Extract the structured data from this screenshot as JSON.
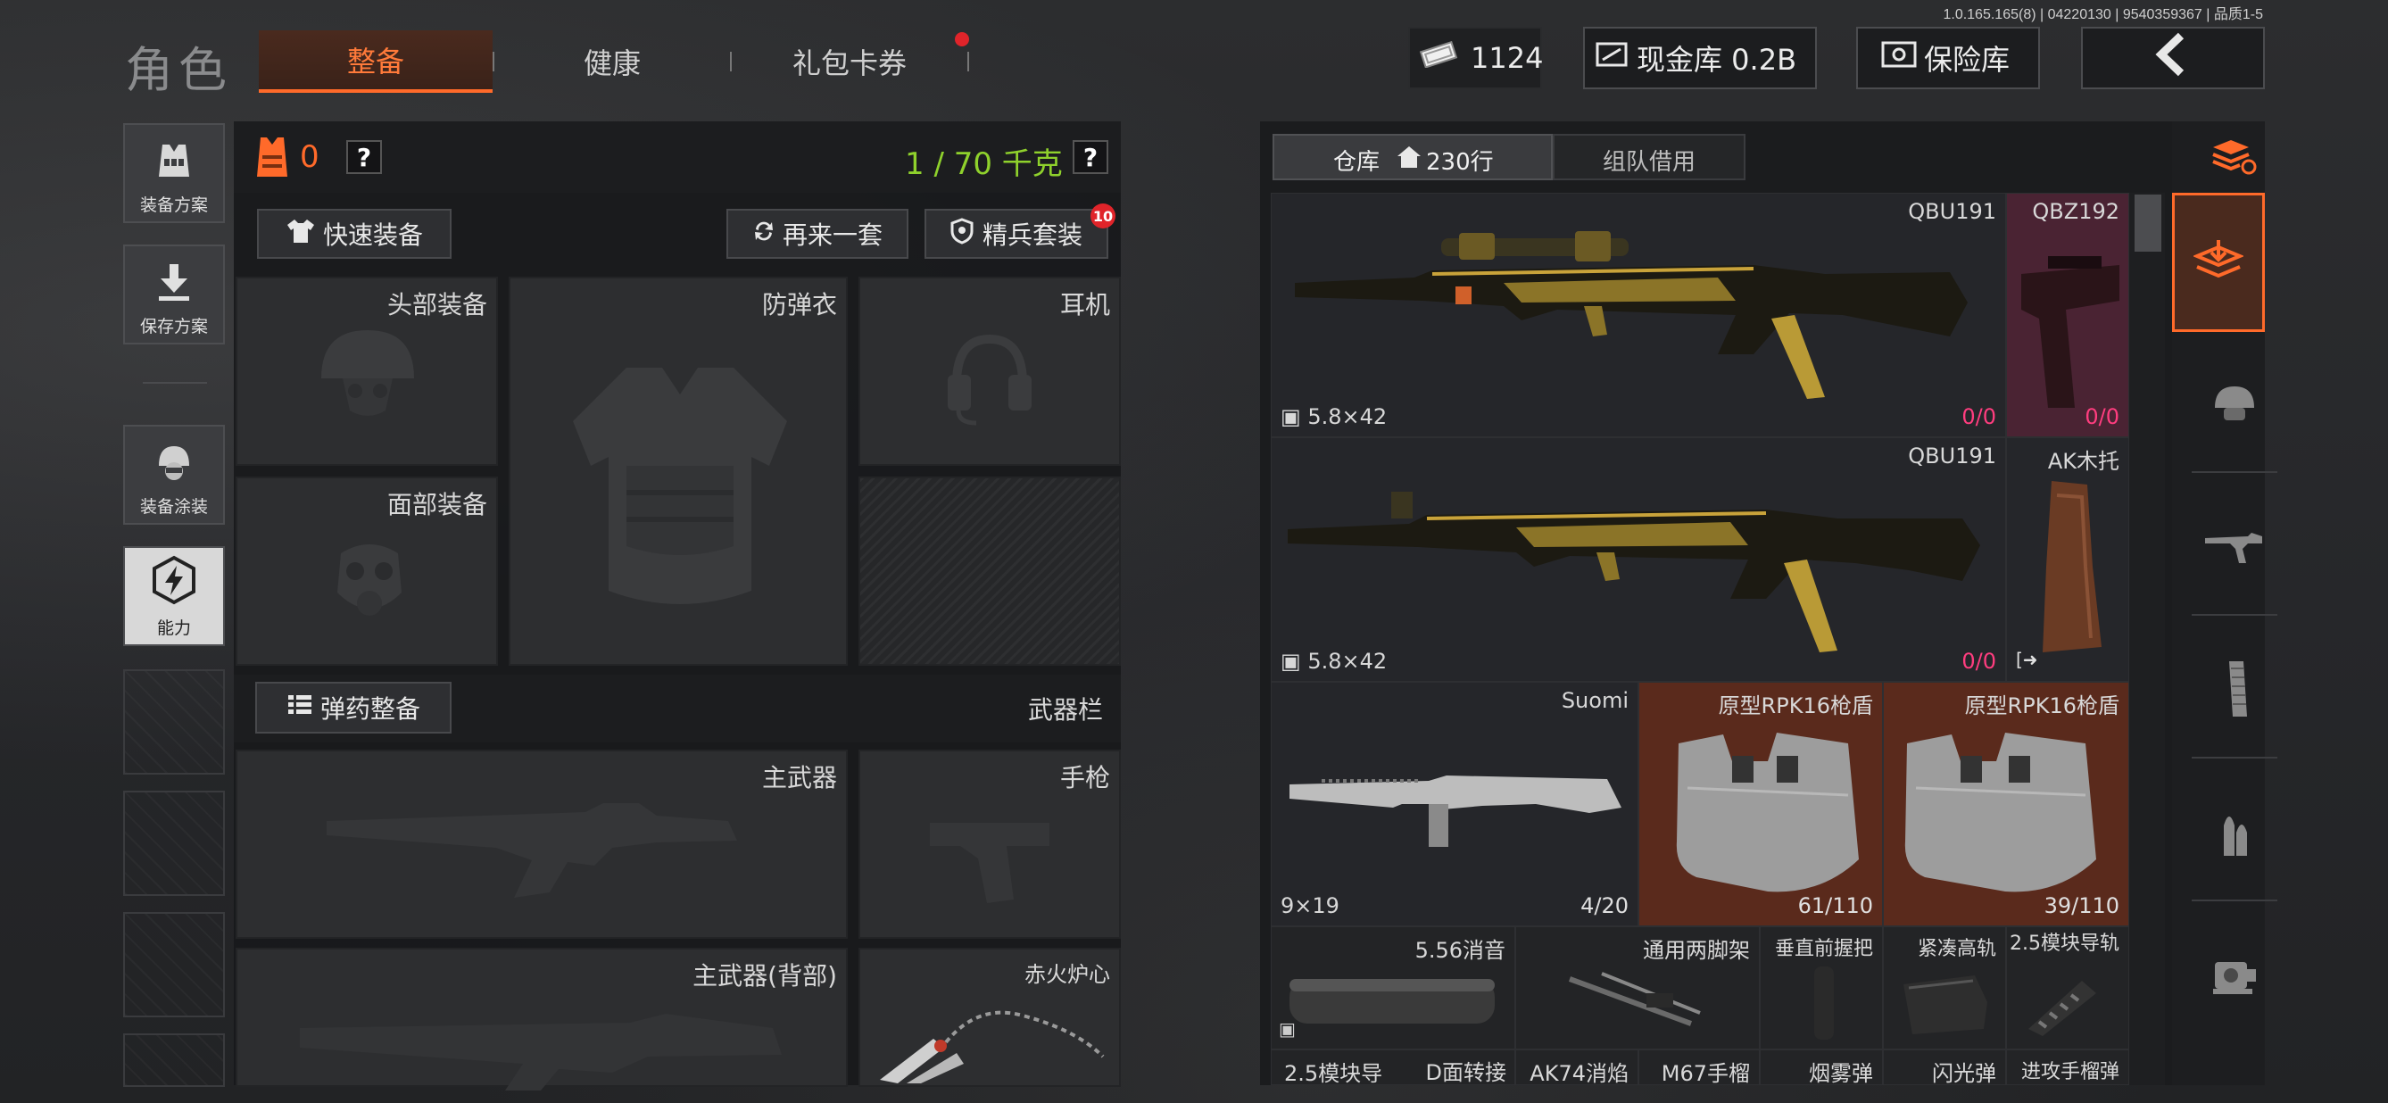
{
  "version_info": "1.0.165.165(8) | 04220130 | 9540359367 | 品质1-5",
  "header": {
    "title": "角色",
    "tabs": [
      {
        "label": "整备",
        "active": true
      },
      {
        "label": "健康"
      },
      {
        "label": "礼包卡券",
        "notify": true
      }
    ],
    "currency_value": "1124",
    "cash_vault_label": "现金库 0.2B",
    "safe_label": "保险库"
  },
  "sidebar": {
    "items": [
      {
        "label": "装备方案"
      },
      {
        "label": "保存方案"
      },
      {
        "label": "装备涂装"
      },
      {
        "label": "能力"
      }
    ]
  },
  "loadout": {
    "armor_count": "0",
    "help": "?",
    "weight": "1 / 70 千克",
    "quick_equip": "快速装备",
    "again_set": "再来一套",
    "elite_set": "精兵套装",
    "elite_badge": "10",
    "slots": {
      "head": "头部装备",
      "vest": "防弹衣",
      "headset": "耳机",
      "face": "面部装备"
    },
    "ammo_btn": "弹药整备",
    "weapon_bar": "武器栏",
    "weapon_slots": {
      "primary": "主武器",
      "pistol": "手枪",
      "primary_back": "主武器(背部)",
      "melee": "赤火炉心"
    }
  },
  "warehouse": {
    "tabs": [
      {
        "label": "仓库"
      },
      {
        "label": "230行"
      },
      {
        "label": "组队借用"
      }
    ],
    "items": [
      {
        "name": "QBU191",
        "caliber": "5.8×42",
        "count": "0/0"
      },
      {
        "name": "QBZ192",
        "count": "0/0"
      },
      {
        "name": "QBU191",
        "caliber": "5.8×42",
        "count": "0/0"
      },
      {
        "name": "AK木托"
      },
      {
        "name": "Suomi",
        "caliber": "9×19",
        "count": "4/20"
      },
      {
        "name": "原型RPK16枪盾",
        "count": "61/110"
      },
      {
        "name": "原型RPK16枪盾",
        "count": "39/110"
      },
      {
        "name": "5.56消音"
      },
      {
        "name": "通用两脚架"
      },
      {
        "name": "垂直前握把"
      },
      {
        "name": "紧凑高轨"
      },
      {
        "name": "2.5模块导轨"
      },
      {
        "name": "2.5模块导"
      },
      {
        "name": "D面转接"
      },
      {
        "name": "AK74消焰"
      },
      {
        "name": "M67手榴"
      },
      {
        "name": "烟雾弹"
      },
      {
        "name": "闪光弹"
      },
      {
        "name": "进攻手榴弹"
      }
    ]
  },
  "colors": {
    "accent": "#ff6a2a",
    "weight_green": "#8fd12c",
    "count_pink": "#ff3d7f",
    "shield_bg": "#5a2a1c"
  }
}
